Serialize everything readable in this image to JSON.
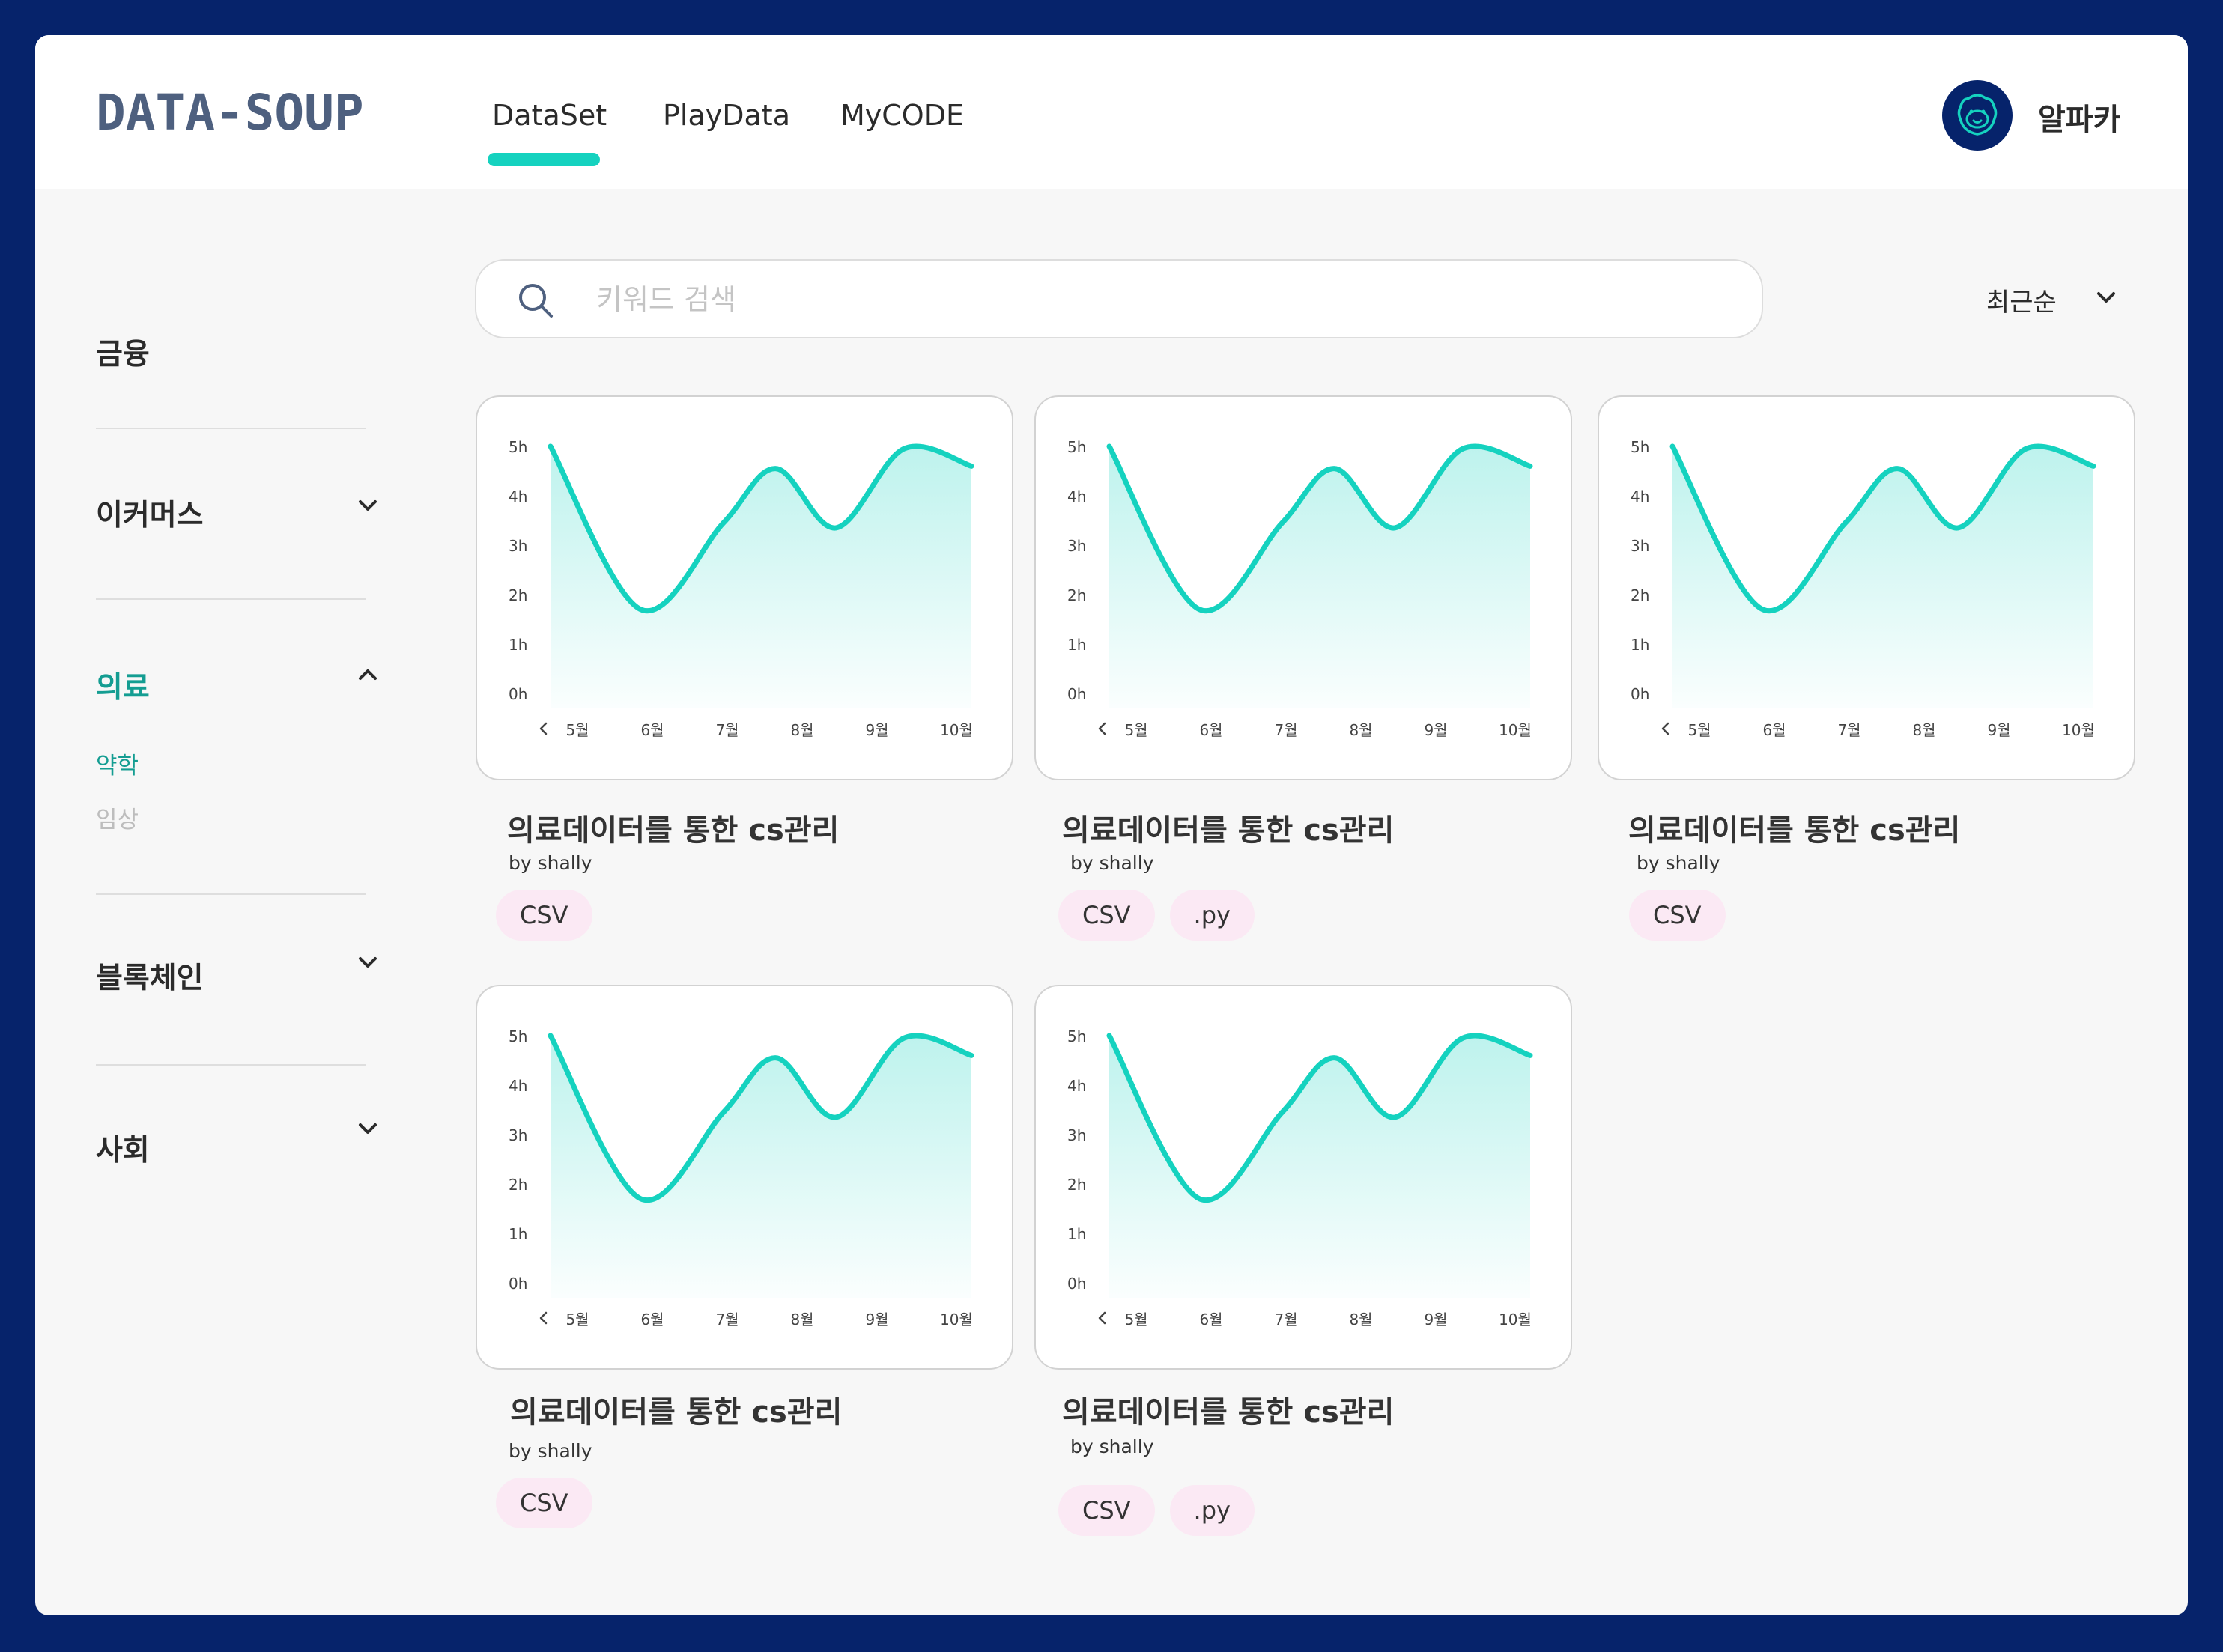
{
  "brand": {
    "logo": "DATA-SOUP",
    "accent": "#15d2bf",
    "navy": "#06236b"
  },
  "nav": {
    "tabs": [
      "DataSet",
      "PlayData",
      "MyCODE"
    ],
    "active": "DataSet"
  },
  "user": {
    "name": "알파카",
    "avatar_icon": "alpaca-icon"
  },
  "sidebar": {
    "categories": [
      {
        "label": "금융"
      },
      {
        "label": "이커머스",
        "state": "collapsed"
      },
      {
        "label": "의료",
        "state": "expanded",
        "subcategories": [
          {
            "label": "약학",
            "selected": true
          },
          {
            "label": "임상",
            "selected": false
          }
        ]
      },
      {
        "label": "블록체인",
        "state": "collapsed"
      },
      {
        "label": "사회",
        "state": "collapsed"
      }
    ]
  },
  "search": {
    "placeholder": "키워드 검색",
    "value": ""
  },
  "sort": {
    "selected": "최근순"
  },
  "chart_data": [
    {
      "type": "area",
      "x": [
        "5월",
        "6월",
        "7월",
        "8월",
        "9월",
        "10월"
      ],
      "y_ticks": [
        "0h",
        "1h",
        "2h",
        "3h",
        "4h",
        "5h"
      ],
      "ylim": [
        0,
        5
      ],
      "points": [
        [
          0,
          5.0
        ],
        [
          1.2,
          1.7
        ],
        [
          2.3,
          3.45
        ],
        [
          3.0,
          4.55
        ],
        [
          3.8,
          3.35
        ],
        [
          4.7,
          4.95
        ],
        [
          5.6,
          4.6
        ]
      ]
    },
    {
      "type": "area",
      "x": [
        "5월",
        "6월",
        "7월",
        "8월",
        "9월",
        "10월"
      ],
      "y_ticks": [
        "0h",
        "1h",
        "2h",
        "3h",
        "4h",
        "5h"
      ],
      "ylim": [
        0,
        5
      ],
      "points": [
        [
          0,
          5.0
        ],
        [
          1.2,
          1.7
        ],
        [
          2.3,
          3.45
        ],
        [
          3.0,
          4.55
        ],
        [
          3.8,
          3.35
        ],
        [
          4.7,
          4.95
        ],
        [
          5.6,
          4.6
        ]
      ]
    },
    {
      "type": "area",
      "x": [
        "5월",
        "6월",
        "7월",
        "8월",
        "9월",
        "10월"
      ],
      "y_ticks": [
        "0h",
        "1h",
        "2h",
        "3h",
        "4h",
        "5h"
      ],
      "ylim": [
        0,
        5
      ],
      "points": [
        [
          0,
          5.0
        ],
        [
          1.2,
          1.7
        ],
        [
          2.3,
          3.45
        ],
        [
          3.0,
          4.55
        ],
        [
          3.8,
          3.35
        ],
        [
          4.7,
          4.95
        ],
        [
          5.6,
          4.6
        ]
      ]
    },
    {
      "type": "area",
      "x": [
        "5월",
        "6월",
        "7월",
        "8월",
        "9월",
        "10월"
      ],
      "y_ticks": [
        "0h",
        "1h",
        "2h",
        "3h",
        "4h",
        "5h"
      ],
      "ylim": [
        0,
        5
      ],
      "points": [
        [
          0,
          5.0
        ],
        [
          1.2,
          1.7
        ],
        [
          2.3,
          3.45
        ],
        [
          3.0,
          4.55
        ],
        [
          3.8,
          3.35
        ],
        [
          4.7,
          4.95
        ],
        [
          5.6,
          4.6
        ]
      ]
    },
    {
      "type": "area",
      "x": [
        "5월",
        "6월",
        "7월",
        "8월",
        "9월",
        "10월"
      ],
      "y_ticks": [
        "0h",
        "1h",
        "2h",
        "3h",
        "4h",
        "5h"
      ],
      "ylim": [
        0,
        5
      ],
      "points": [
        [
          0,
          5.0
        ],
        [
          1.2,
          1.7
        ],
        [
          2.3,
          3.45
        ],
        [
          3.0,
          4.55
        ],
        [
          3.8,
          3.35
        ],
        [
          4.7,
          4.95
        ],
        [
          5.6,
          4.6
        ]
      ]
    }
  ],
  "cards": [
    {
      "title": "의료데이터를 통한 cs관리",
      "author": "by shally",
      "tags": [
        "CSV"
      ]
    },
    {
      "title": "의료데이터를 통한 cs관리",
      "author": "by shally",
      "tags": [
        "CSV",
        ".py"
      ]
    },
    {
      "title": "의료데이터를 통한 cs관리",
      "author": "by shally",
      "tags": [
        "CSV"
      ]
    },
    {
      "title": "의료데이터를 통한 cs관리",
      "author": "by shally",
      "tags": [
        "CSV"
      ]
    },
    {
      "title": "의료데이터를 통한 cs관리",
      "author": "by shally",
      "tags": [
        "CSV",
        ".py"
      ]
    }
  ]
}
